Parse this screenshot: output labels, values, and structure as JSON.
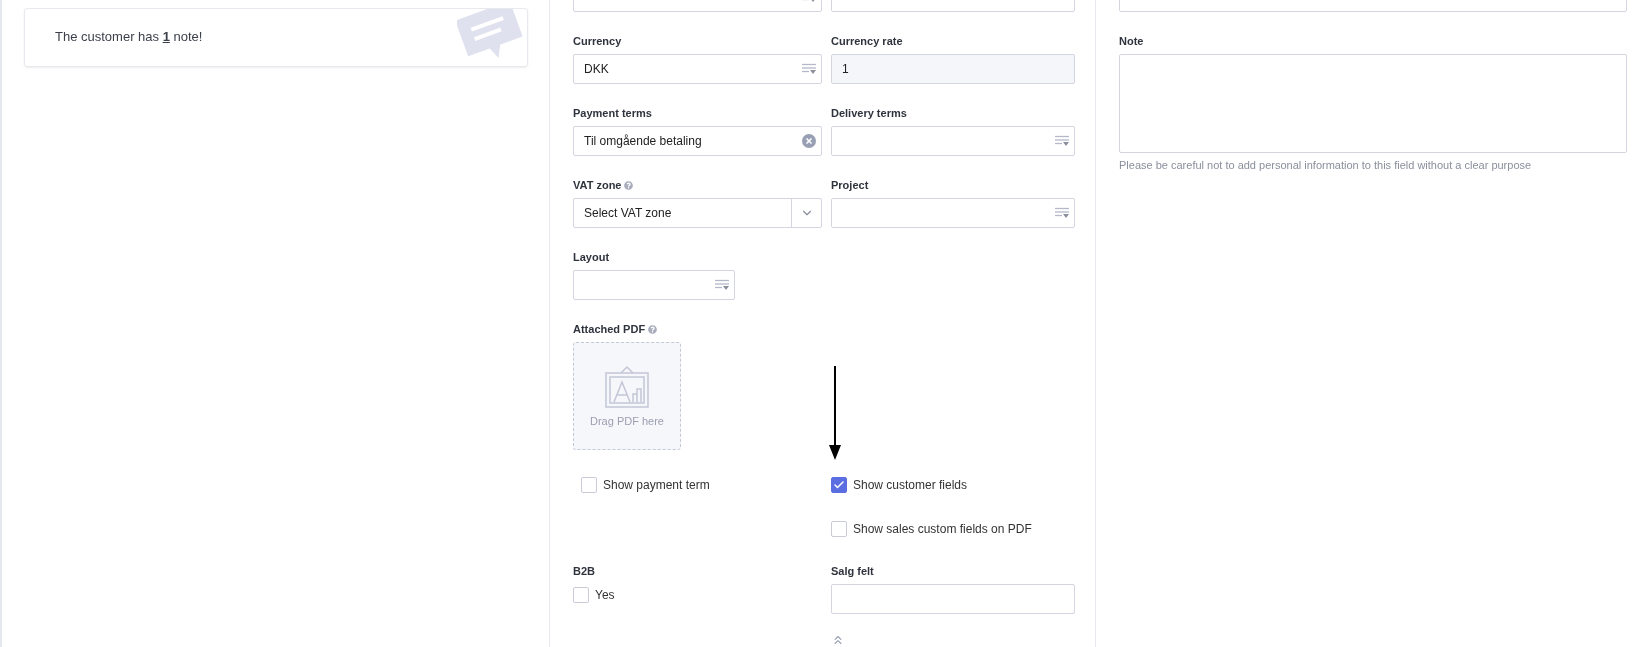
{
  "note_card": {
    "text": "The customer has **1** note!"
  },
  "top_fields": [
    {
      "kind": "picker"
    },
    {
      "kind": "text"
    }
  ],
  "form_rows": [
    [
      {
        "label": "Currency",
        "kind": "picker",
        "value": "DKK"
      },
      {
        "label": "Currency rate",
        "kind": "readonly",
        "value": "1"
      }
    ],
    [
      {
        "label": "Payment terms",
        "kind": "clearable",
        "value": "Til omgående betaling"
      },
      {
        "label": "Delivery terms",
        "kind": "picker"
      }
    ],
    [
      {
        "label": "VAT zone",
        "kind": "dropdown",
        "help": true,
        "value": "Select VAT zone"
      },
      {
        "label": "Project",
        "kind": "picker"
      }
    ],
    [
      {
        "label": "Layout",
        "kind": "picker"
      }
    ]
  ],
  "attached_pdf": {
    "label": "Attached PDF",
    "help": true,
    "hint": "Drag PDF here"
  },
  "options_left": [
    {
      "label": "Show payment term",
      "checked": false
    }
  ],
  "options_right": [
    {
      "label": "Show customer fields",
      "checked": true
    },
    {
      "label": "Show sales custom fields on PDF",
      "checked": false
    }
  ],
  "b2b": {
    "label": "B2B",
    "option": {
      "label": "Yes",
      "checked": false
    }
  },
  "salg_felt": {
    "label": "Salg felt"
  },
  "right_top_field": {
    "kind": "text"
  },
  "note": {
    "label": "Note",
    "hint": "Please be careful not to add personal information to this field without a clear purpose"
  }
}
